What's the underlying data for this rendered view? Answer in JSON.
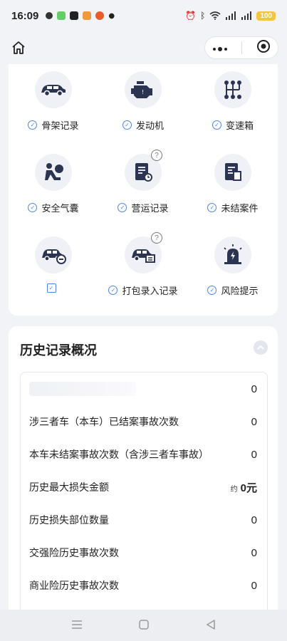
{
  "status_bar": {
    "time": "16:09",
    "battery": "100"
  },
  "nav": {
    "home_icon": "home-icon",
    "menu_icon": "more-dots-icon",
    "close_icon": "target-icon"
  },
  "features": [
    {
      "label": "骨架记录",
      "icon": "car-frame-icon",
      "help": false
    },
    {
      "label": "发动机",
      "icon": "engine-icon",
      "help": false
    },
    {
      "label": "变速箱",
      "icon": "gearbox-icon",
      "help": false
    },
    {
      "label": "安全气囊",
      "icon": "airbag-icon",
      "help": false
    },
    {
      "label": "营运记录",
      "icon": "operation-record-icon",
      "help": true
    },
    {
      "label": "未结案件",
      "icon": "open-case-icon",
      "help": false
    },
    {
      "label": "",
      "icon": "car-damage-icon",
      "help": false
    },
    {
      "label": "打包录入记录",
      "icon": "package-record-icon",
      "help": true
    },
    {
      "label": "风险提示",
      "icon": "risk-alert-icon",
      "help": false
    }
  ],
  "history": {
    "title": "历史记录概况",
    "rows": [
      {
        "label": "",
        "value": "0"
      },
      {
        "label": "涉三者车（本车）已结案事故次数",
        "value": "0"
      },
      {
        "label": "本车未结案事故次数（含涉三者车事故）",
        "value": "0"
      },
      {
        "label": "历史最大损失金额",
        "prefix": "约",
        "value": "0元"
      },
      {
        "label": "历史损失部位数量",
        "value": "0"
      },
      {
        "label": "交强险历史事故次数",
        "value": "0"
      },
      {
        "label": "商业险历史事故次数",
        "value": "0"
      }
    ]
  },
  "colors": {
    "accent": "#4a86e8",
    "icon_dark": "#2b3552"
  }
}
